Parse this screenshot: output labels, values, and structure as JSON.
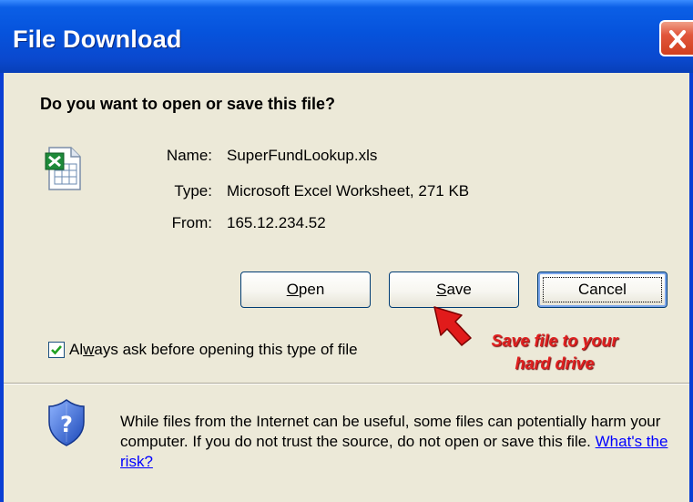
{
  "window": {
    "title": "File Download",
    "close_icon": "close-icon"
  },
  "dialog": {
    "heading": "Do you want to open or save this file?",
    "file_icon": "excel-file-icon",
    "name_label": "Name:",
    "name_value": "SuperFundLookup.xls",
    "type_label": "Type:",
    "type_value": "Microsoft Excel Worksheet, 271 KB",
    "from_label": "From:",
    "from_value": "165.12.234.52"
  },
  "buttons": {
    "open_label": "Open",
    "open_mnemonic": "O",
    "save_label": "Save",
    "save_mnemonic": "S",
    "cancel_label": "Cancel"
  },
  "checkbox": {
    "checked": true,
    "label": "Always ask before opening this type of file",
    "mnemonic": "w"
  },
  "annotation": {
    "line1": "Save file to your",
    "line2": "hard drive",
    "color": "#e02020"
  },
  "warning": {
    "icon": "security-shield-icon",
    "text": "While files from the Internet can be useful, some files can potentially harm your computer. If you do not trust the source, do not open or save this file.",
    "link": "What's the risk?"
  },
  "colors": {
    "titlebar": "#0653dc",
    "dialog_bg": "#ece9d8",
    "close_button": "#e1563b",
    "link": "#0000ff"
  }
}
